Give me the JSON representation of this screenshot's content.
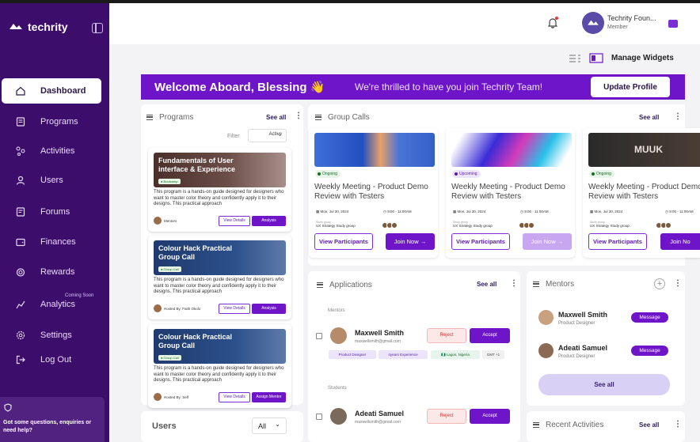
{
  "app": {
    "name": "techrity"
  },
  "sidebar": {
    "items": [
      {
        "label": "Dashboard",
        "icon": "home-icon"
      },
      {
        "label": "Programs",
        "icon": "programs-icon"
      },
      {
        "label": "Activities",
        "icon": "activities-icon"
      },
      {
        "label": "Users",
        "icon": "user-icon"
      },
      {
        "label": "Forums",
        "icon": "forum-icon"
      },
      {
        "label": "Finances",
        "icon": "wallet-icon"
      },
      {
        "label": "Rewards",
        "icon": "reward-icon"
      },
      {
        "label": "Analytics",
        "icon": "chart-icon",
        "badge": "Coming Soon"
      },
      {
        "label": "Settings",
        "icon": "gear-icon"
      },
      {
        "label": "Log Out",
        "icon": "logout-icon"
      }
    ],
    "help_text": "Got some questions, enquiries or need help?"
  },
  "header": {
    "user_name": "Techrity Foun...",
    "user_role": "Member"
  },
  "widgets": {
    "label": "Manage Widgets"
  },
  "banner": {
    "title": "Welcome Aboard, Blessing 👋",
    "subtitle": "We're thrilled to have you join Techrity Team!",
    "button": "Update Profile"
  },
  "programs": {
    "title": "Programs",
    "see_all": "See all",
    "filter_label": "Filter",
    "filter_value": "Active",
    "items": [
      {
        "title": "Fundamentals of User interface & Experience",
        "tag": "● Bootcamp",
        "desc": "This  program is a hands-on guide designed for designers who want to master color theory and confidently apply it to their designs. This practical approach",
        "host": "Mentors",
        "btn1": "View Details",
        "btn2": "Analysis"
      },
      {
        "title": "Colour Hack Practical Group Call",
        "tag": "● Group Call",
        "desc": "This  program is a hands-on guide designed for designers who want to master color theory and confidently apply it to their designs. This practical approach",
        "host": "Hosted By: Faith Okolo",
        "btn1": "View Details",
        "btn2": "Analysis"
      },
      {
        "title": "Colour Hack Practical Group Call",
        "tag": "● Group Call",
        "desc": "This  program is a hands-on guide designed for designers who want to master color theory and confidently apply it to their designs. This practical approach",
        "host": "Hosted By: Self",
        "btn1": "View Details",
        "btn2": "Assign Mentor"
      }
    ]
  },
  "group_calls": {
    "title": "Group Calls",
    "see_all": "See all",
    "items": [
      {
        "status": "Ongoing",
        "title": "Weekly Meeting - Product Demo Review with Testers",
        "date": "Mon, Jul 30, 2024",
        "time": "9:00 - 11:00AM",
        "group_label": "Study group",
        "group": "UX Strategy Study group",
        "participants_label": "Participants",
        "view": "View Participants",
        "join": "Join Now  →"
      },
      {
        "status": "Upcoming",
        "title": "Weekly Meeting - Product Demo Review with Testers",
        "date": "Mon, Jul 30, 2024",
        "time": "9:00 - 11:00AM",
        "group_label": "Study group",
        "group": "UX Strategy Study group",
        "participants_label": "Participants",
        "view": "View Participants",
        "join": "Join Now  →"
      },
      {
        "status": "Ongoing",
        "title": "Weekly Meeting - Product Demo Review with Testers",
        "date": "Mon, Jul 30, 2024",
        "time": "9:00 - 11:00AM",
        "group_label": "Study group",
        "group": "UX Strategy Study group",
        "participants_label": "Participants",
        "view": "View Participants",
        "join": "Join No"
      }
    ],
    "brand_text": "MUUK"
  },
  "applications": {
    "title": "Applications",
    "see_all": "See all",
    "mentors_label": "Mentors",
    "students_label": "Students",
    "mentor": {
      "name": "Maxwell Smith",
      "email": "maxwellsmith@gmail.com",
      "reject": "Reject",
      "accept": "Accept",
      "chips": [
        "Product Designer",
        "4years Experience",
        "🇳🇬 Lagos, Nigeria",
        "GMT +1"
      ]
    },
    "student": {
      "name": "Adeati Samuel",
      "email": "maxwellsmith@gmail.com",
      "reject": "Reject",
      "accept": "Accept"
    }
  },
  "mentors": {
    "title": "Mentors",
    "see_all": "See all",
    "items": [
      {
        "name": "Maxwell Smith",
        "role": "Product Designer",
        "btn": "Message"
      },
      {
        "name": "Adeati Samuel",
        "role": "Product Designer",
        "btn": "Message"
      }
    ]
  },
  "users": {
    "title": "Users",
    "filter": "All"
  },
  "recent": {
    "title": "Recent Activities",
    "see_all": "See all"
  },
  "colors": {
    "brand": "#6e15c9",
    "sidebar": "#3d0d6b",
    "ongoing": "#1b6b26",
    "upcoming": "#5a1ba8"
  }
}
